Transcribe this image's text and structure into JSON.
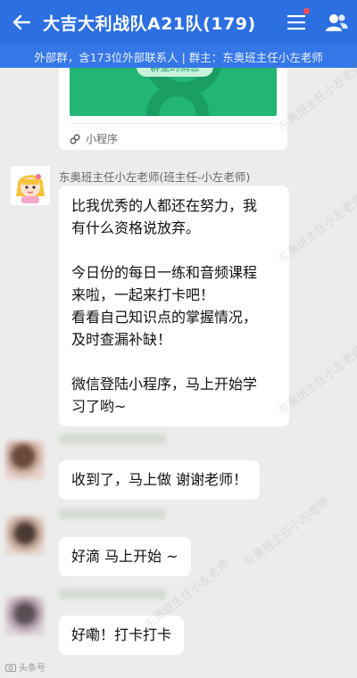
{
  "header": {
    "title": "大吉大利战队A21队(179)",
    "subtitle": "外部群，含173位外部联系人 | 群主：东奥班主任小左老师"
  },
  "mini_program": {
    "label": "小程序",
    "button_text": "群里的消息"
  },
  "teacher": {
    "sender": "东奥班主任小左老师(班主任-小左老师)",
    "message_lines": [
      "比我优秀的人都还在努力，我",
      "有什么资格说放弃。",
      "",
      "今日份的每日一练和音频课程",
      "来啦，一起来打卡吧！",
      "看看自己知识点的掌握情况，",
      "及时查漏补缺！",
      "",
      "微信登陆小程序，马上开始学",
      "习了哟~"
    ]
  },
  "students": [
    {
      "message": "收到了，马上做 谢谢老师！"
    },
    {
      "message": "好滴 马上开始 ~"
    },
    {
      "message": "好嘞！打卡打卡"
    }
  ],
  "watermark": "东奥班主任小左老师",
  "footer_badge": "头条号",
  "colors": {
    "header_bg": "#2b6fe0",
    "subbar_bg": "#3577e6",
    "chat_bg": "#ececec",
    "mini_program_green": "#22b573",
    "notification_dot": "#ff4d4f"
  },
  "icons": {
    "back": "back-arrow-icon",
    "menu": "menu-icon",
    "contacts": "contacts-icon",
    "mini_program": "mini-program-icon"
  }
}
